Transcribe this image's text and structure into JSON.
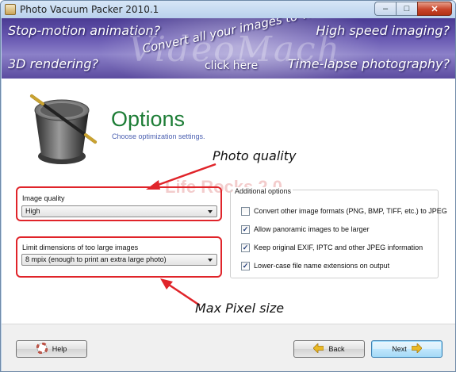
{
  "window": {
    "title": "Photo Vacuum Packer 2010.1",
    "controls": {
      "minimize": "–",
      "maximize": "□",
      "close": "✕"
    }
  },
  "banner": {
    "top_left": "Stop-motion animation?",
    "top_right": "High speed imaging?",
    "bottom_left": "3D rendering?",
    "bottom_right": "Time-lapse photography?",
    "center": "Convert all your images to video!",
    "brand": "VideoMach",
    "link": "click here"
  },
  "header": {
    "title": "Options",
    "subtitle": "Choose optimization settings."
  },
  "watermark": "Life Rocks 2.0",
  "image_quality": {
    "label": "Image quality",
    "value": "High"
  },
  "limit_dimensions": {
    "label": "Limit dimensions of too large images",
    "value": "8 mpix   (enough to print an extra large photo)"
  },
  "additional_options": {
    "title": "Additional options",
    "items": [
      {
        "label": "Convert other image formats (PNG, BMP, TIFF, etc.) to JPEG",
        "checked": false
      },
      {
        "label": "Allow panoramic images to be larger",
        "checked": true
      },
      {
        "label": "Keep original EXIF, IPTC and other JPEG information",
        "checked": true
      },
      {
        "label": "Lower-case file name extensions on output",
        "checked": true
      }
    ]
  },
  "annotations": {
    "photo_quality": "Photo quality",
    "max_pixel": "Max Pixel size",
    "color": "#e0242a"
  },
  "buttons": {
    "help": "Help",
    "back": "Back",
    "next": "Next"
  }
}
